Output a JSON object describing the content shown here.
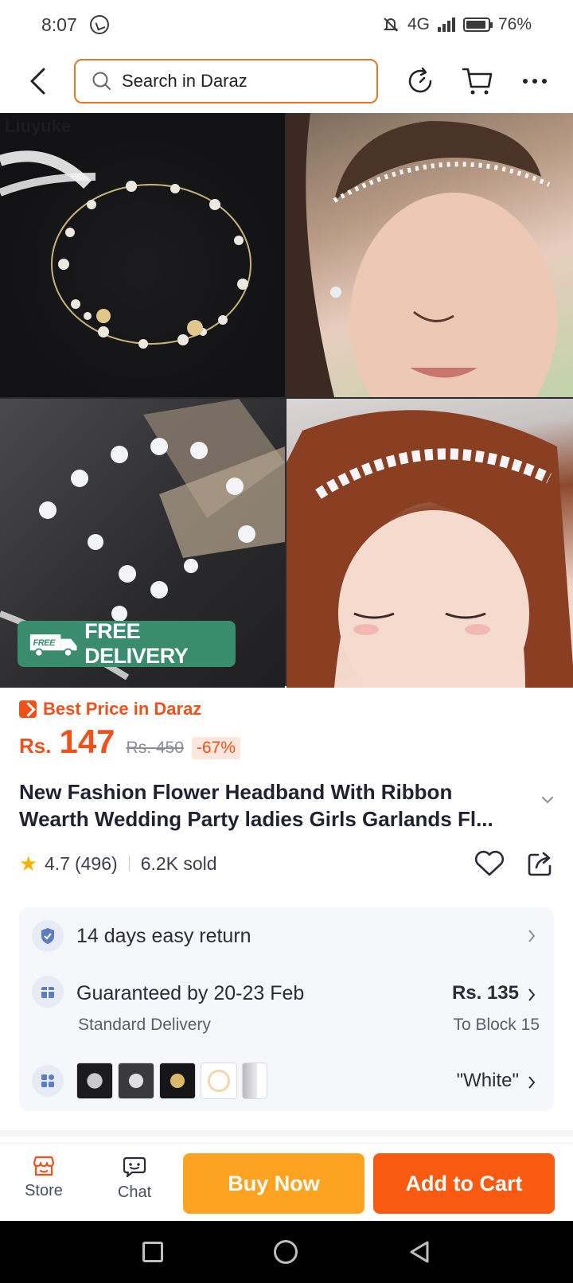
{
  "status_bar": {
    "time": "8:07",
    "network": "4G",
    "battery": "76%"
  },
  "nav": {
    "search_placeholder": "Search in Daraz"
  },
  "gallery": {
    "watermark": "Liuyuke",
    "free_delivery": "FREE DELIVERY",
    "free_tag": "FREE"
  },
  "product": {
    "best_price_label": "Best Price in Daraz",
    "currency": "Rs.",
    "price": "147",
    "original_price": "Rs. 450",
    "discount": "-67%",
    "title_line1": "New Fashion Flower Headband With Ribbon",
    "title_line2": "Wearth Wedding Party ladies Girls Garlands Fl...",
    "rating": "4.7",
    "reviews": "(496)",
    "sold": "6.2K sold"
  },
  "info": {
    "return_text": "14 days easy return",
    "delivery_text": "Guaranteed by 20-23 Feb",
    "delivery_sub": "Standard Delivery",
    "delivery_price": "Rs. 135",
    "delivery_location": "To Block 15",
    "variant_selected": "\"White\""
  },
  "action_bar": {
    "store_label": "Store",
    "chat_label": "Chat",
    "buy_now": "Buy Now",
    "add_to_cart": "Add to Cart"
  },
  "colors": {
    "accent": "#f0511b",
    "buy_now": "#fda321",
    "add_to_cart": "#f85a11",
    "free_delivery": "#3a8c6e"
  }
}
